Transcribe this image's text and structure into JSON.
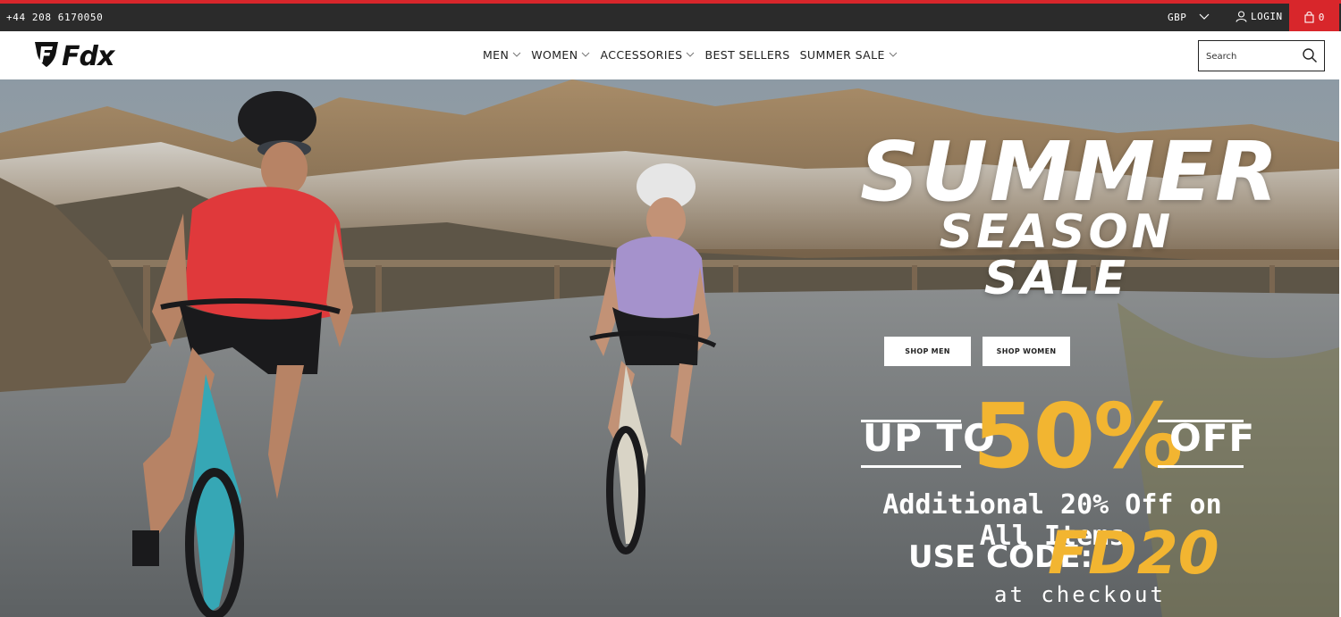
{
  "topbar": {
    "phone": "+44 208 6170050",
    "currency": "GBP",
    "login_label": "LOGIN",
    "cart_count": "0",
    "accent_color": "#d8262b"
  },
  "header": {
    "logo_text": "Fdx",
    "nav": [
      {
        "label": "MEN",
        "has_dropdown": true
      },
      {
        "label": "WOMEN",
        "has_dropdown": true
      },
      {
        "label": "ACCESSORIES",
        "has_dropdown": true
      },
      {
        "label": "BEST SELLERS",
        "has_dropdown": false
      },
      {
        "label": "SUMMER SALE",
        "has_dropdown": true
      }
    ],
    "search_placeholder": "Search"
  },
  "hero": {
    "title": "SUMMER",
    "subtitle": "SEASON SALE",
    "shop_men": "SHOP MEN",
    "shop_women": "SHOP WOMEN",
    "up_to": "UP TO",
    "discount": "50%",
    "off": "OFF",
    "additional": "Additional 20% Off on All Items",
    "use_code": "USE CODE:",
    "code": "FD20",
    "checkout": "at checkout",
    "highlight_color": "#f2b531"
  },
  "icons": [
    "chevron-down-icon",
    "user-icon",
    "bag-icon",
    "search-icon",
    "fdx-shield-logo"
  ]
}
